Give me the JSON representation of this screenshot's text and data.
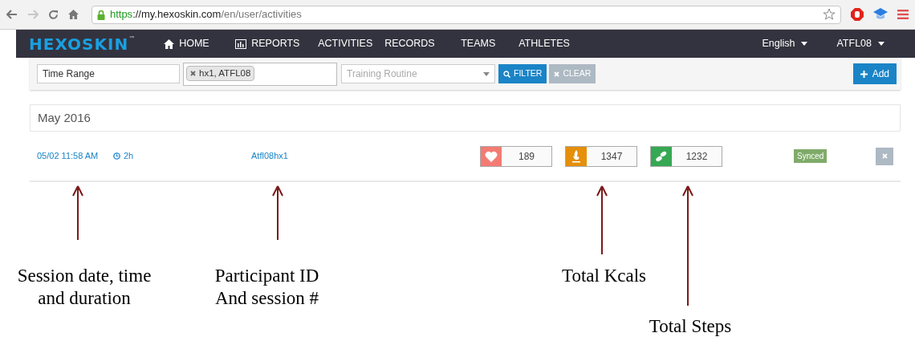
{
  "browser": {
    "url_scheme": "https",
    "url_host": "://my.hexoskin.com",
    "url_path": "/en/user/activities"
  },
  "nav": {
    "logo": "HEXOSKIN",
    "trademark": "™",
    "items": [
      {
        "label": "HOME",
        "kind": "home"
      },
      {
        "label": "REPORTS",
        "kind": "chart"
      },
      {
        "label": "ACTIVITIES",
        "kind": "plain"
      },
      {
        "label": "RECORDS",
        "kind": "plain"
      },
      {
        "label": "TEAMS",
        "kind": "plain"
      },
      {
        "label": "ATHLETES",
        "kind": "plain"
      }
    ],
    "language": "English",
    "user": "ATFL08"
  },
  "filters": {
    "time_range": "Time Range",
    "tags": [
      "hx1, ATFL08"
    ],
    "routine_placeholder": "Training Routine",
    "filter_button": "FILTER",
    "clear_button": "CLEAR",
    "add_button": "Add"
  },
  "month": "May 2016",
  "sessions": [
    {
      "datetime": "05/02 11:58 AM",
      "duration": "2h",
      "participant": "Atfl08hx1",
      "metrics": [
        {
          "kind": "heart",
          "value": "189",
          "color": "#f47b73"
        },
        {
          "kind": "kcal",
          "value": "1347",
          "color": "#e58f0b"
        },
        {
          "kind": "steps",
          "value": "1232",
          "color": "#36a853"
        }
      ],
      "status": "Synced",
      "synced": true
    }
  ],
  "annotations": [
    {
      "lines": [
        "Session date, time",
        "and duration"
      ]
    },
    {
      "lines": [
        "Participant ID",
        "And session #"
      ]
    },
    {
      "lines": [
        "Total Kcals"
      ]
    },
    {
      "lines": [
        "Total Steps"
      ]
    }
  ]
}
